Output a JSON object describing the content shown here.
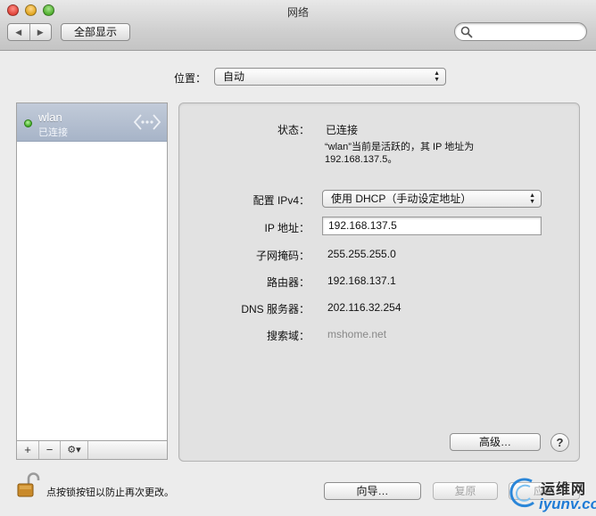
{
  "window": {
    "title": "网络"
  },
  "toolbar": {
    "back_icon": "◀",
    "forward_icon": "▶",
    "show_all_label": "全部显示",
    "search": {
      "placeholder": "",
      "value": ""
    }
  },
  "location": {
    "label": "位置：",
    "value": "自动"
  },
  "services": [
    {
      "name": "wlan",
      "status": "已连接",
      "status_color": "#3faa22",
      "icon": "ethernet-arrows-icon"
    }
  ],
  "list_controls": {
    "add": "+",
    "remove": "−",
    "gear": "⚙▾"
  },
  "detail": {
    "status_label": "状态：",
    "status_value": "已连接",
    "status_desc_line1": "“wlan”当前是活跃的，其 IP 地址为",
    "status_desc_line2": "192.168.137.5。",
    "config_label": "配置 IPv4：",
    "config_value": "使用 DHCP（手动设定地址）",
    "ip_label": "IP 地址：",
    "ip_value": "192.168.137.5",
    "subnet_label": "子网掩码：",
    "subnet_value": "255.255.255.0",
    "router_label": "路由器：",
    "router_value": "192.168.137.1",
    "dns_label": "DNS 服务器：",
    "dns_value": "202.116.32.254",
    "search_domain_label": "搜索域：",
    "search_domain_value": "mshome.net",
    "advanced_label": "高级…",
    "help_label": "?"
  },
  "footer": {
    "lock_text": "点按锁按钮以防止再次更改。",
    "assist_label": "向导…",
    "revert_label": "复原",
    "apply_label": "应用"
  },
  "watermark": {
    "top": "运维网",
    "bottom": "iyunv.com"
  }
}
